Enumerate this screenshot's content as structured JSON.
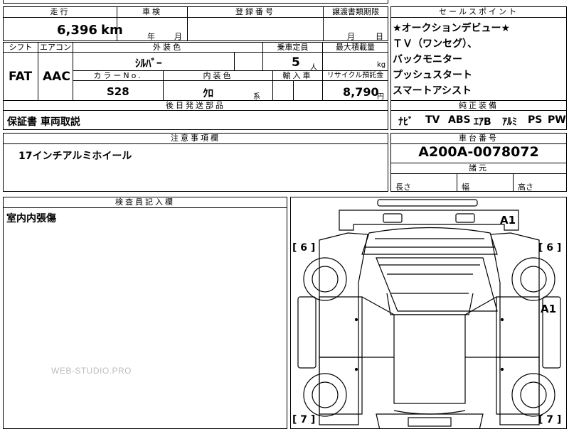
{
  "top": {
    "mileage_label": "走行",
    "mileage_value": "6,396",
    "mileage_unit": "km",
    "inspection_label": "車検",
    "inspection_year": "年",
    "inspection_month": "月",
    "registration_label": "登録番号",
    "transfer_label": "譲渡書類期限",
    "transfer_month": "月",
    "transfer_day": "日"
  },
  "mid": {
    "shift_label": "シフト",
    "ac_label": "エアコン",
    "exterior_label": "外装色",
    "capacity_label": "乗車定員",
    "maxload_label": "最大積載量",
    "shift_value": "FAT",
    "ac_value": "AAC",
    "exterior_value": "ｼﾙﾊﾞｰ",
    "capacity_value": "5",
    "capacity_unit": "人",
    "maxload_unit": "kg",
    "colorno_label": "カラーNo.",
    "interior_label": "内装色",
    "import_label": "輸入車",
    "recycle_label": "リサイクル預託金",
    "colorno_value": "S28",
    "interior_value": "ｸﾛ",
    "interior_unit": "系",
    "recycle_value": "8,790",
    "recycle_unit": "円",
    "later_label": "後日発送部品",
    "later_value": "保証書 車両取説"
  },
  "sales": {
    "title": "セールスポイント",
    "points": [
      "★オークションデビュー★",
      "ＴＶ（ワンセグ）、",
      "バックモニター",
      "プッシュスタート",
      "スマートアシスト"
    ]
  },
  "genuine": {
    "title": "純正装備",
    "items": [
      "ﾅﾋﾞ",
      "TV",
      "ABS",
      "ｴｱB",
      "ｱﾙﾐ",
      "PS",
      "PW"
    ]
  },
  "notes": {
    "title": "注意事項欄",
    "text": "17インチアルミホイール"
  },
  "chassis": {
    "title": "車台番号",
    "value": "A200A-0078072",
    "dims_title": "諸元",
    "length": "長さ",
    "width": "幅",
    "height": "高さ"
  },
  "inspector": {
    "title": "検査員記入欄",
    "text": "室内内張傷"
  },
  "diagram": {
    "mark_a1_top": "A1",
    "mark_a1_right": "A1",
    "left_front": "[ 6 ]",
    "right_front": "[ 6 ]",
    "left_rear": "[ 7 ]",
    "right_rear": "[ 7 ]"
  },
  "watermark": "WEB-STUDIO.PRO"
}
